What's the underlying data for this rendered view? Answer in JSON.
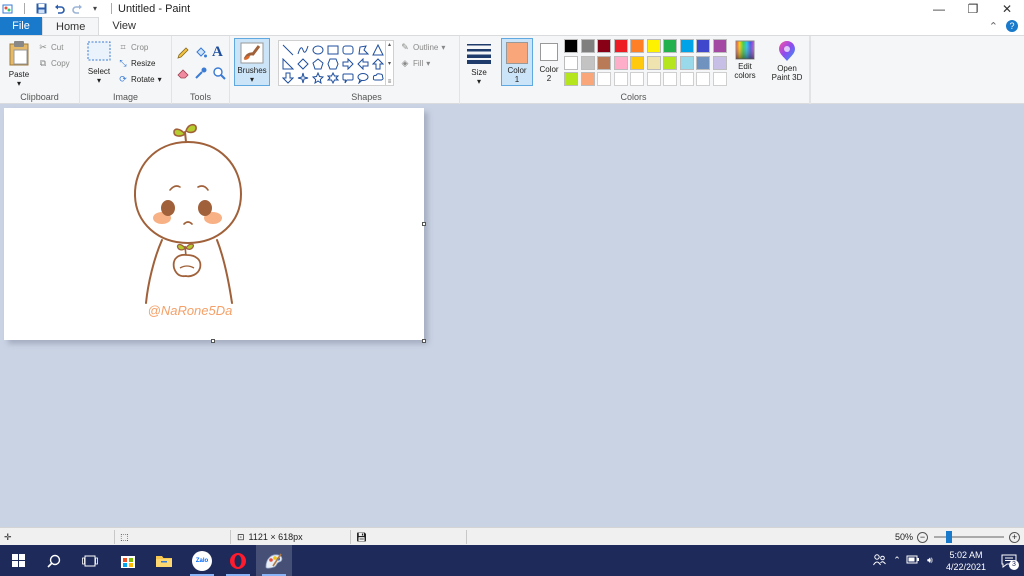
{
  "window": {
    "title": "Untitled - Paint",
    "controls": {
      "minimize": "—",
      "restore": "❐",
      "close": "✕"
    }
  },
  "tabs": [
    {
      "label": "File"
    },
    {
      "label": "Home"
    },
    {
      "label": "View"
    }
  ],
  "ribbon": {
    "clipboard": {
      "paste": "Paste",
      "cut": "Cut",
      "copy": "Copy",
      "label": "Clipboard"
    },
    "image": {
      "select": "Select",
      "crop": "Crop",
      "resize": "Resize",
      "rotate": "Rotate",
      "label": "Image"
    },
    "tools": {
      "label": "Tools",
      "text_glyph": "A"
    },
    "brushes": {
      "label": "Brushes"
    },
    "shapes": {
      "outline": "Outline",
      "fill": "Fill",
      "label": "Shapes"
    },
    "size": {
      "label": "Size"
    },
    "colors": {
      "color1": "Color 1",
      "color1_line1": "Color",
      "color1_line2": "1",
      "color2_line1": "Color",
      "color2_line2": "2",
      "color1_value": "#f9a77a",
      "color2_value": "#ffffff",
      "edit_line1": "Edit",
      "edit_line2": "colors",
      "paint3d_line1": "Open",
      "paint3d_line2": "Paint 3D",
      "label": "Colors",
      "palette_row1": [
        "#000000",
        "#7f7f7f",
        "#880015",
        "#ed1c24",
        "#ff7f27",
        "#fff200",
        "#22b14c",
        "#00a2e8",
        "#3f48cc",
        "#a349a4"
      ],
      "palette_row2": [
        "#ffffff",
        "#c3c3c3",
        "#b97a57",
        "#ffaec9",
        "#ffc90e",
        "#efe4b0",
        "#b5e61d",
        "#99d9ea",
        "#7092be",
        "#c8bfe7"
      ],
      "palette_row3": [
        "#b5e61d",
        "#f9a77a"
      ]
    }
  },
  "canvas": {
    "drawing_caption": "@NaRone5Da",
    "line_color": "#a0613a",
    "sprout_color": "#b5cc2e",
    "blush_color": "#f7b184",
    "caption_color": "#f5a068"
  },
  "statusbar": {
    "dimensions": "1121 × 618px",
    "zoom": "50%"
  },
  "taskbar": {
    "apps": [
      "start-icon",
      "search-icon",
      "task-view-icon",
      "store-icon",
      "file-explorer-icon",
      "zalo-icon",
      "opera-icon",
      "paint-icon"
    ],
    "zalo_label": "Zalo",
    "time": "5:02 AM",
    "date": "4/22/2021",
    "notification_count": "3"
  }
}
